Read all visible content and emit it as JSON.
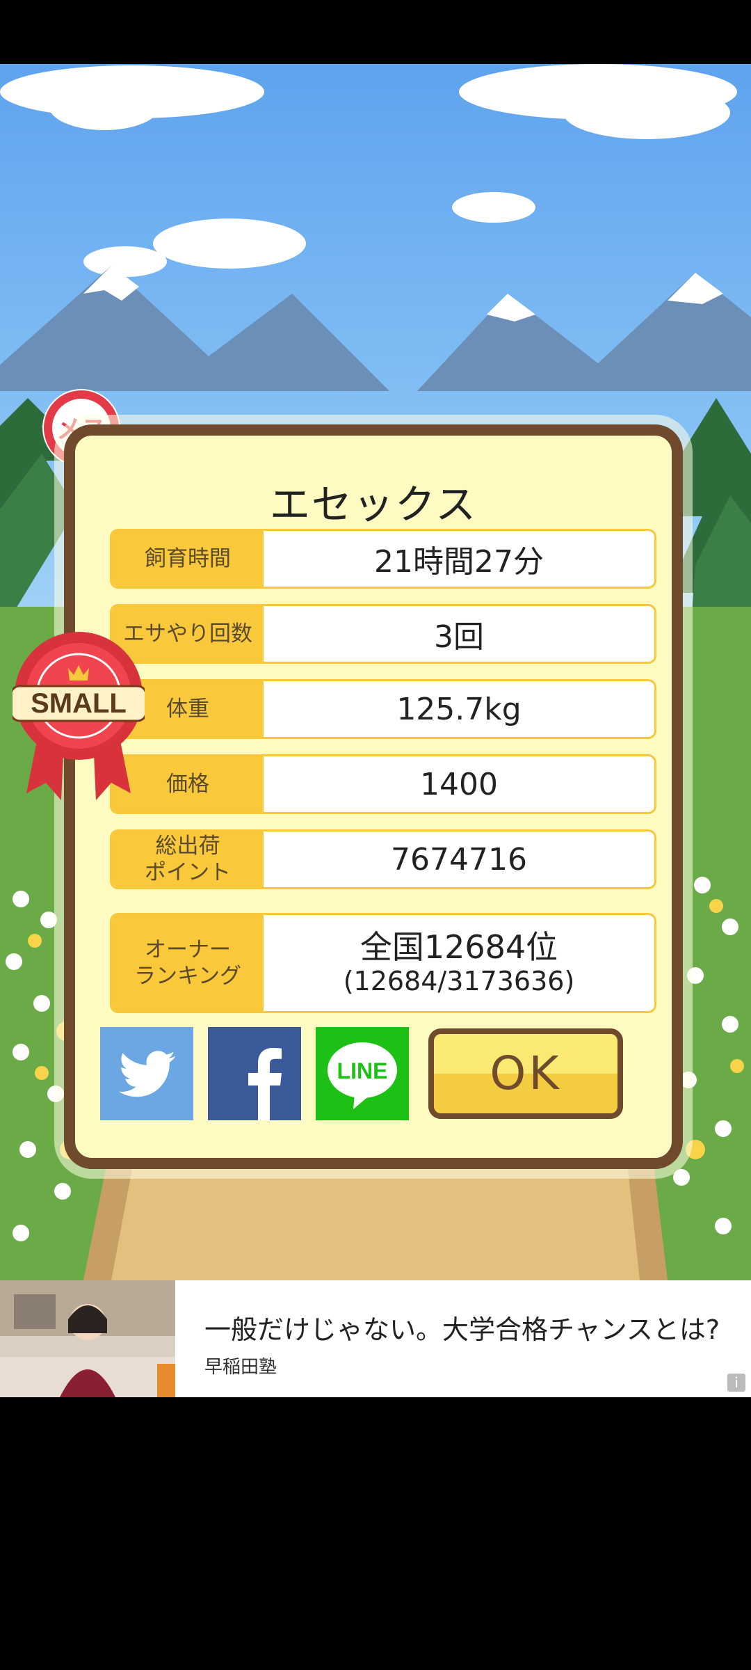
{
  "colors": {
    "card_bg": "#fdfac2",
    "card_border": "#6f4a2c",
    "label_bg": "#f9c93b",
    "twitter": "#6aa7e3",
    "facebook": "#3b5a9a",
    "line": "#1dc116",
    "ok_top": "#faea74",
    "ok_bottom": "#f4cc3f",
    "female_badge": "#e23a47"
  },
  "dialog": {
    "title": "エセックス",
    "female_badge_text": "メス",
    "size_badge_text": "SMALL",
    "stats": [
      {
        "label": "飼育時間",
        "value": "21時間27分"
      },
      {
        "label": "エサやり回数",
        "value": "3回"
      },
      {
        "label": "体重",
        "value": "125.7kg"
      },
      {
        "label": "価格",
        "value": "1400"
      },
      {
        "label": "総出荷\nポイント",
        "value": "7674716"
      }
    ],
    "ranking": {
      "label": "オーナー\nランキング",
      "value": "全国12684位",
      "detail": "(12684/3173636)"
    },
    "share": {
      "twitter_icon": "twitter-bird-icon",
      "facebook_icon": "facebook-f-icon",
      "line_icon": "line-logo-icon",
      "line_text": "LINE"
    },
    "ok_label": "OK"
  },
  "ad": {
    "headline": "一般だけじゃない。大学合格チャンスとは?",
    "advertiser": "早稲田塾",
    "info_icon": "info-icon",
    "info_glyph": "i"
  }
}
